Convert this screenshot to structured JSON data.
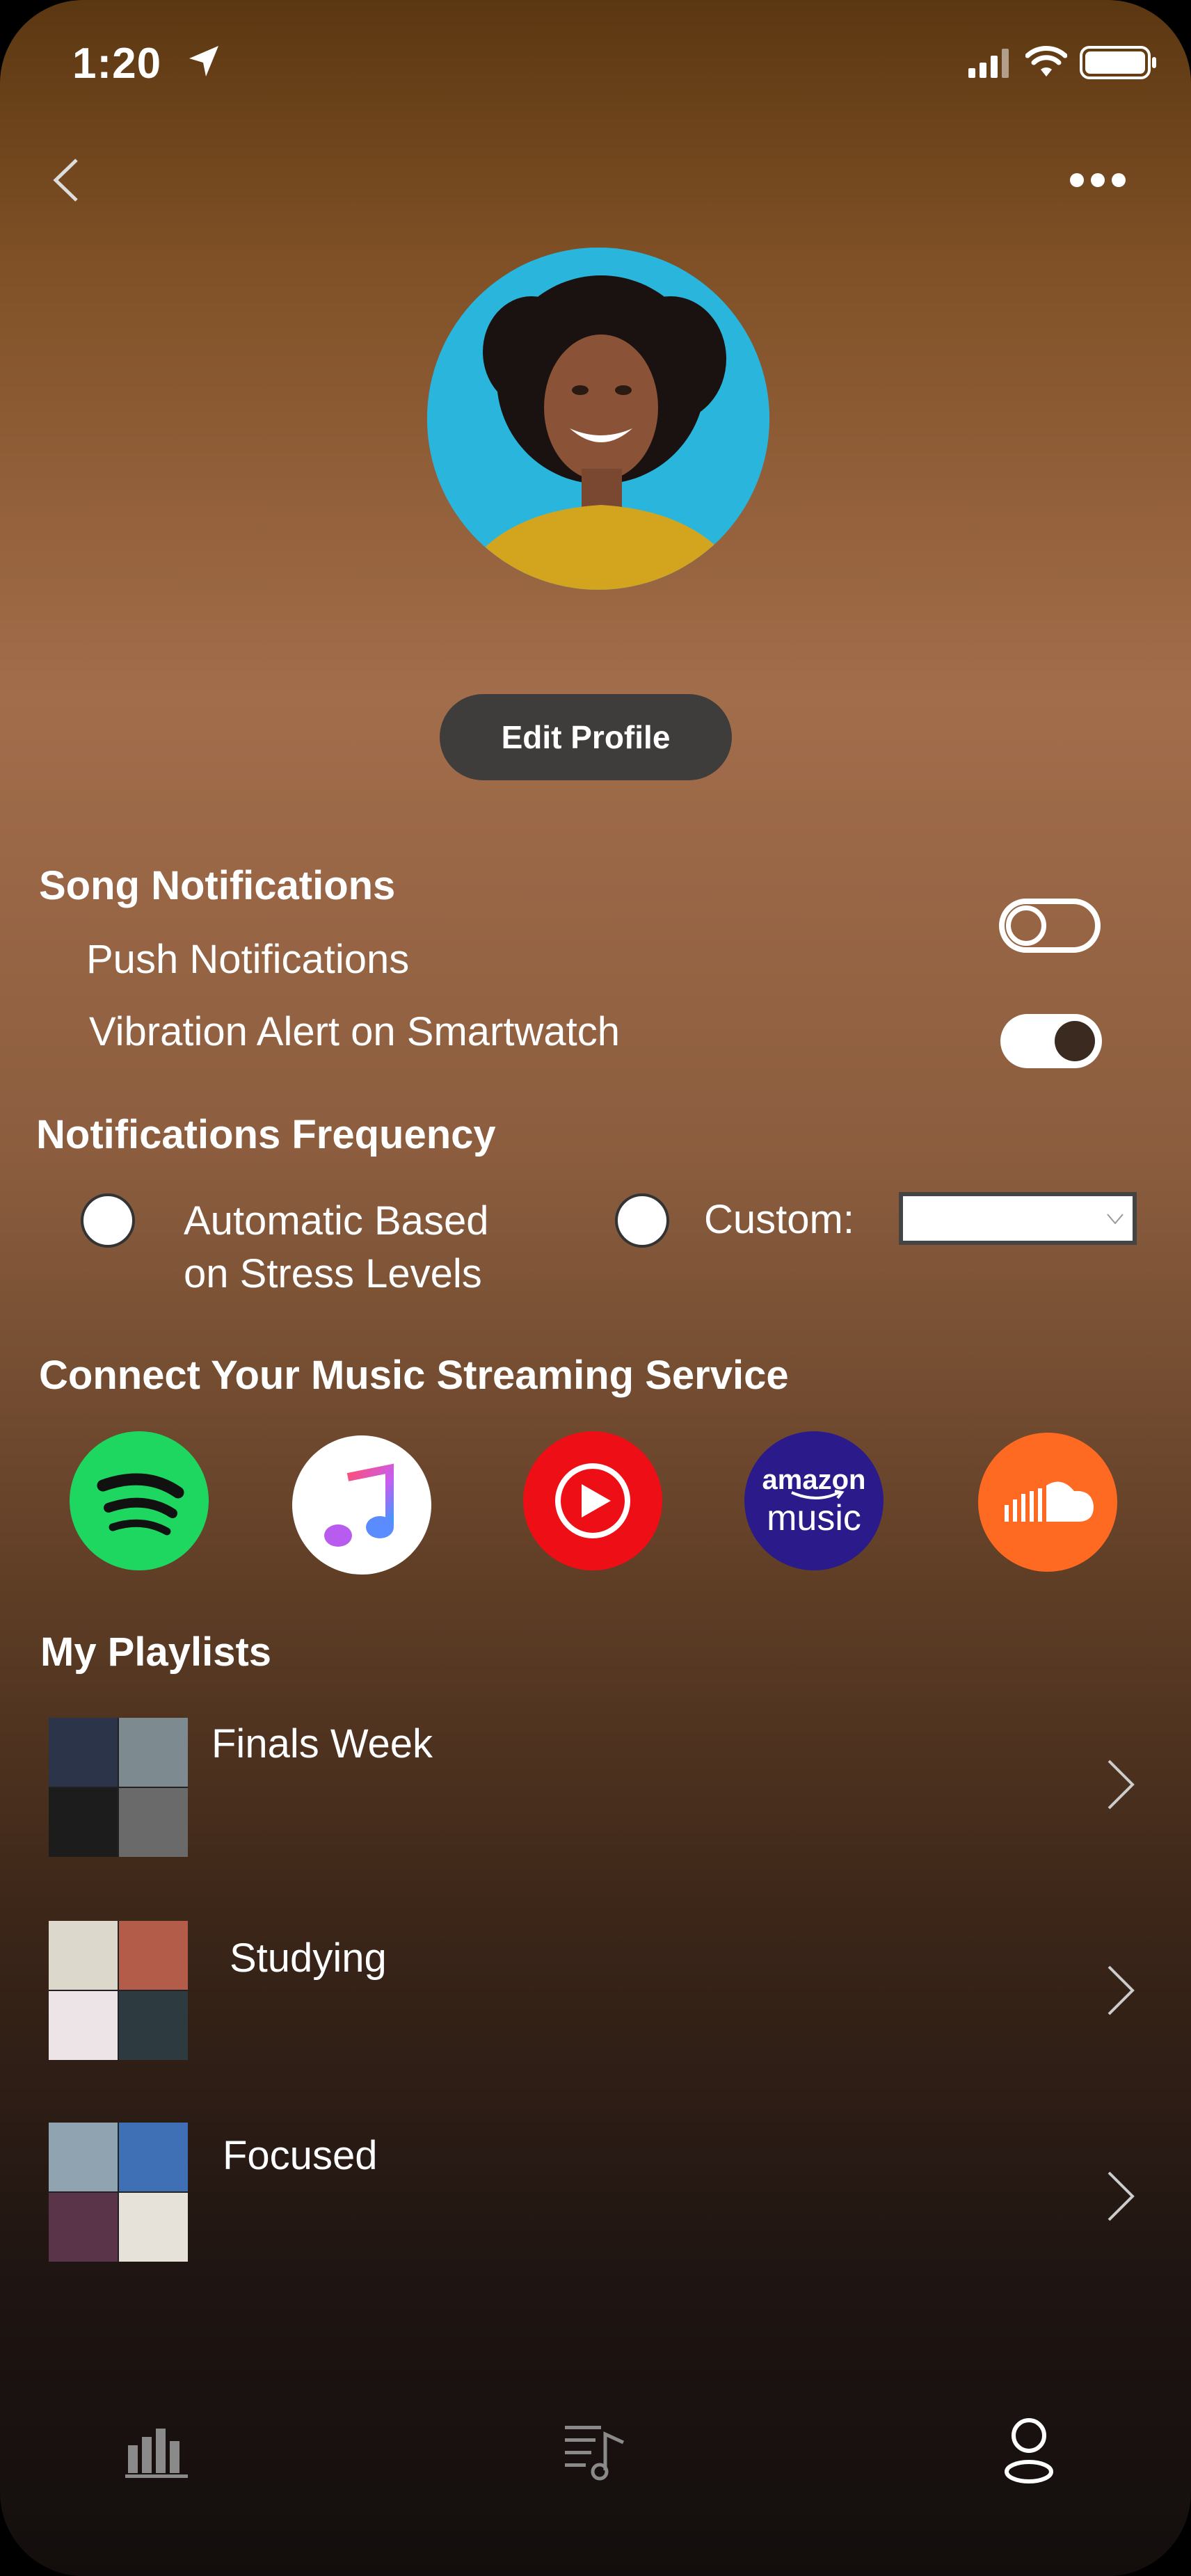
{
  "status_bar": {
    "time": "1:20"
  },
  "header": {
    "back_icon": "chevron-left-icon",
    "more_icon": "ellipsis-icon"
  },
  "profile": {
    "edit_label": "Edit Profile"
  },
  "song_notifications": {
    "title": "Song Notifications",
    "items": [
      {
        "label": "Push Notifications",
        "enabled": false
      },
      {
        "label": "Vibration Alert on Smartwatch",
        "enabled": true
      }
    ]
  },
  "frequency": {
    "title": "Notifications Frequency",
    "automatic_line1": "Automatic Based",
    "automatic_line2": "on Stress Levels",
    "custom_label": "Custom:",
    "custom_value": ""
  },
  "streaming": {
    "title": "Connect Your Music Streaming Service",
    "services": [
      {
        "icon": "spotify-icon",
        "color": "#1ed760"
      },
      {
        "icon": "apple-music-icon",
        "color": "#ffffff"
      },
      {
        "icon": "youtube-music-icon",
        "color": "#ff0000"
      },
      {
        "icon": "amazon-music-icon",
        "color": "#2f1e8c",
        "text1": "amazon",
        "text2": "music"
      },
      {
        "icon": "soundcloud-icon",
        "color": "#ff6a22"
      }
    ]
  },
  "playlists": {
    "title": "My Playlists",
    "items": [
      {
        "name": "Finals Week"
      },
      {
        "name": "Studying"
      },
      {
        "name": "Focused"
      }
    ]
  },
  "tab_bar": {
    "items": [
      "stats-icon",
      "playlist-icon",
      "profile-icon"
    ]
  }
}
